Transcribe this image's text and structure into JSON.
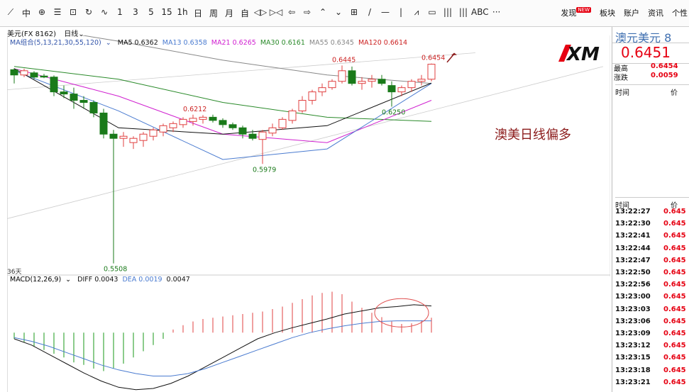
{
  "toolbar": {
    "items": [
      "⟋",
      "中",
      "⊕",
      "☰",
      "⊡",
      "↻",
      "∿",
      "1",
      "3",
      "5",
      "15",
      "1h",
      "日",
      "周",
      "月",
      "自",
      "◁▷",
      "▷◁",
      "⇦",
      "⇨",
      "⌃",
      "⌄",
      "⊞",
      "/",
      "—",
      "|",
      "⩘",
      "▭",
      "|||",
      "|||",
      "ABC",
      "···"
    ],
    "menus": [
      "发现",
      "板块",
      "账户",
      "资讯",
      "个性"
    ],
    "badge": "NEW"
  },
  "subbar": {
    "symbol": "美元(FX 8162)",
    "period": "日线"
  },
  "legend": {
    "group": "MA组合(5,13,21,30,55,120)",
    "items": [
      {
        "label": "MA5 0.6362",
        "color": "#111111"
      },
      {
        "label": "MA13 0.6358",
        "color": "#4a7bd0"
      },
      {
        "label": "MA21 0.6265",
        "color": "#d020d0"
      },
      {
        "label": "MA30 0.6161",
        "color": "#2a8a2a"
      },
      {
        "label": "MA55 0.6345",
        "color": "#888888"
      },
      {
        "label": "MA120 0.6614",
        "color": "#cc2222"
      }
    ]
  },
  "macd_legend": {
    "title": "MACD(12,26,9)",
    "items": [
      {
        "label": "DIFF 0.0043",
        "color": "#111111"
      },
      {
        "label": "DEA 0.0019",
        "color": "#4a7bd0"
      },
      {
        "label": "0.0047",
        "color": "#111111"
      }
    ]
  },
  "days_label": "36天",
  "annotation": "澳美日线偏多",
  "logo_text": "XM",
  "sidebar": {
    "title": "澳元美元 8",
    "price": "0.6451",
    "high_label": "最高",
    "high_value": "0.6454",
    "change_label": "涨跌",
    "change_value": "0.0059",
    "time_header": "时间",
    "price_header": "价",
    "ticks": [
      {
        "time": "13:22:27",
        "price": "0.645"
      },
      {
        "time": "13:22:30",
        "price": "0.645"
      },
      {
        "time": "13:22:41",
        "price": "0.645"
      },
      {
        "time": "13:22:44",
        "price": "0.645"
      },
      {
        "time": "13:22:47",
        "price": "0.645"
      },
      {
        "time": "13:22:50",
        "price": "0.645"
      },
      {
        "time": "13:22:56",
        "price": "0.645"
      },
      {
        "time": "13:23:00",
        "price": "0.645"
      },
      {
        "time": "13:23:03",
        "price": "0.645"
      },
      {
        "time": "13:23:06",
        "price": "0.645"
      },
      {
        "time": "13:23:09",
        "price": "0.645"
      },
      {
        "time": "13:23:12",
        "price": "0.645"
      },
      {
        "time": "13:23:15",
        "price": "0.645"
      },
      {
        "time": "13:23:18",
        "price": "0.645"
      },
      {
        "time": "13:23:21",
        "price": "0.645"
      }
    ]
  },
  "chart_data": {
    "type": "candlestick",
    "colors": {
      "up": "#e04040",
      "down": "#1a7a1a"
    },
    "ylim": [
      0.548,
      0.652
    ],
    "candles": [
      {
        "o": 0.6425,
        "h": 0.6432,
        "l": 0.636,
        "c": 0.64
      },
      {
        "o": 0.64,
        "h": 0.643,
        "l": 0.639,
        "c": 0.642
      },
      {
        "o": 0.641,
        "h": 0.6418,
        "l": 0.638,
        "c": 0.639
      },
      {
        "o": 0.6395,
        "h": 0.6405,
        "l": 0.6385,
        "c": 0.639
      },
      {
        "o": 0.639,
        "h": 0.6398,
        "l": 0.63,
        "c": 0.632
      },
      {
        "o": 0.632,
        "h": 0.635,
        "l": 0.629,
        "c": 0.631
      },
      {
        "o": 0.631,
        "h": 0.634,
        "l": 0.624,
        "c": 0.628
      },
      {
        "o": 0.628,
        "h": 0.63,
        "l": 0.624,
        "c": 0.627
      },
      {
        "o": 0.627,
        "h": 0.628,
        "l": 0.62,
        "c": 0.622
      },
      {
        "o": 0.622,
        "h": 0.624,
        "l": 0.61,
        "c": 0.612
      },
      {
        "o": 0.612,
        "h": 0.614,
        "l": 0.5508,
        "c": 0.61
      },
      {
        "o": 0.61,
        "h": 0.613,
        "l": 0.606,
        "c": 0.611
      },
      {
        "o": 0.608,
        "h": 0.611,
        "l": 0.605,
        "c": 0.61
      },
      {
        "o": 0.609,
        "h": 0.613,
        "l": 0.606,
        "c": 0.612
      },
      {
        "o": 0.611,
        "h": 0.615,
        "l": 0.609,
        "c": 0.614
      },
      {
        "o": 0.613,
        "h": 0.617,
        "l": 0.611,
        "c": 0.616
      },
      {
        "o": 0.615,
        "h": 0.618,
        "l": 0.613,
        "c": 0.617
      },
      {
        "o": 0.6165,
        "h": 0.62,
        "l": 0.615,
        "c": 0.619
      },
      {
        "o": 0.618,
        "h": 0.6212,
        "l": 0.616,
        "c": 0.6195
      },
      {
        "o": 0.619,
        "h": 0.621,
        "l": 0.617,
        "c": 0.62
      },
      {
        "o": 0.62,
        "h": 0.6212,
        "l": 0.6175,
        "c": 0.6185
      },
      {
        "o": 0.6185,
        "h": 0.6195,
        "l": 0.615,
        "c": 0.6165
      },
      {
        "o": 0.6165,
        "h": 0.6175,
        "l": 0.614,
        "c": 0.615
      },
      {
        "o": 0.615,
        "h": 0.616,
        "l": 0.61,
        "c": 0.612
      },
      {
        "o": 0.612,
        "h": 0.614,
        "l": 0.609,
        "c": 0.61
      },
      {
        "o": 0.6095,
        "h": 0.614,
        "l": 0.5979,
        "c": 0.613
      },
      {
        "o": 0.6125,
        "h": 0.617,
        "l": 0.611,
        "c": 0.615
      },
      {
        "o": 0.615,
        "h": 0.62,
        "l": 0.614,
        "c": 0.619
      },
      {
        "o": 0.6185,
        "h": 0.624,
        "l": 0.617,
        "c": 0.623
      },
      {
        "o": 0.623,
        "h": 0.63,
        "l": 0.622,
        "c": 0.628
      },
      {
        "o": 0.628,
        "h": 0.633,
        "l": 0.626,
        "c": 0.632
      },
      {
        "o": 0.632,
        "h": 0.636,
        "l": 0.63,
        "c": 0.634
      },
      {
        "o": 0.634,
        "h": 0.638,
        "l": 0.633,
        "c": 0.637
      },
      {
        "o": 0.637,
        "h": 0.6445,
        "l": 0.636,
        "c": 0.642
      },
      {
        "o": 0.642,
        "h": 0.644,
        "l": 0.635,
        "c": 0.636
      },
      {
        "o": 0.636,
        "h": 0.639,
        "l": 0.633,
        "c": 0.637
      },
      {
        "o": 0.637,
        "h": 0.64,
        "l": 0.634,
        "c": 0.638
      },
      {
        "o": 0.638,
        "h": 0.64,
        "l": 0.635,
        "c": 0.636
      },
      {
        "o": 0.635,
        "h": 0.637,
        "l": 0.625,
        "c": 0.632
      },
      {
        "o": 0.632,
        "h": 0.635,
        "l": 0.63,
        "c": 0.634
      },
      {
        "o": 0.634,
        "h": 0.638,
        "l": 0.632,
        "c": 0.637
      },
      {
        "o": 0.637,
        "h": 0.64,
        "l": 0.635,
        "c": 0.638
      },
      {
        "o": 0.638,
        "h": 0.6454,
        "l": 0.637,
        "c": 0.6451
      }
    ],
    "price_labels": [
      {
        "index": 10,
        "value": "0.5508",
        "at": "low"
      },
      {
        "index": 18,
        "value": "0.6212",
        "at": "high"
      },
      {
        "index": 25,
        "value": "0.5979",
        "at": "low"
      },
      {
        "index": 33,
        "value": "0.6445",
        "at": "high"
      },
      {
        "index": 38,
        "value": "0.6250",
        "at": "low"
      },
      {
        "index": 42,
        "value": "0.6454",
        "at": "high"
      }
    ],
    "ma_lines": [
      {
        "name": "MA120",
        "color": "#cc2222",
        "values": [
          0.672,
          0.669,
          0.666,
          0.664,
          0.662
        ]
      },
      {
        "name": "MA55",
        "color": "#888888",
        "values": [
          0.664,
          0.656,
          0.647,
          0.64,
          0.636
        ]
      },
      {
        "name": "MA30",
        "color": "#2a8a2a",
        "values": [
          0.644,
          0.638,
          0.627,
          0.62,
          0.618
        ]
      },
      {
        "name": "MA21",
        "color": "#d020d0",
        "values": [
          0.643,
          0.63,
          0.612,
          0.608,
          0.628
        ]
      },
      {
        "name": "MA13",
        "color": "#4a7bd0",
        "values": [
          0.642,
          0.623,
          0.6,
          0.605,
          0.636
        ]
      },
      {
        "name": "MA5",
        "color": "#111111",
        "values": [
          0.643,
          0.615,
          0.612,
          0.616,
          0.6362
        ]
      }
    ],
    "macd": {
      "ylim": [
        -0.009,
        0.007
      ],
      "hist": [
        -0.001,
        -0.0015,
        -0.0022,
        -0.0028,
        -0.0034,
        -0.004,
        -0.0048,
        -0.0052,
        -0.0058,
        -0.0062,
        -0.0058,
        -0.005,
        -0.004,
        -0.003,
        -0.002,
        -0.001,
        0.0005,
        0.0012,
        0.0018,
        0.0022,
        0.0024,
        0.0026,
        0.0028,
        0.003,
        0.0032,
        0.0034,
        0.0038,
        0.0042,
        0.0048,
        0.0054,
        0.006,
        0.0064,
        0.0066,
        0.0062,
        0.005,
        0.004,
        0.0032,
        0.0025,
        0.0018,
        0.0014,
        0.0015,
        0.002,
        0.0024
      ],
      "diff": [
        -0.001,
        -0.002,
        -0.0035,
        -0.005,
        -0.0065,
        -0.0078,
        -0.0088,
        -0.0092,
        -0.009,
        -0.0082,
        -0.007,
        -0.0055,
        -0.004,
        -0.0025,
        -0.001,
        0.0,
        0.0008,
        0.0015,
        0.0022,
        0.003,
        0.0035,
        0.004,
        0.0042,
        0.0045,
        0.0043
      ],
      "dea": [
        -0.0008,
        -0.0014,
        -0.0022,
        -0.0032,
        -0.0042,
        -0.0052,
        -0.006,
        -0.0066,
        -0.007,
        -0.007,
        -0.0066,
        -0.0058,
        -0.0048,
        -0.0038,
        -0.0028,
        -0.0018,
        -0.0008,
        0.0,
        0.0006,
        0.0011,
        0.0015,
        0.0018,
        0.0019,
        0.0019,
        0.0019
      ]
    }
  }
}
